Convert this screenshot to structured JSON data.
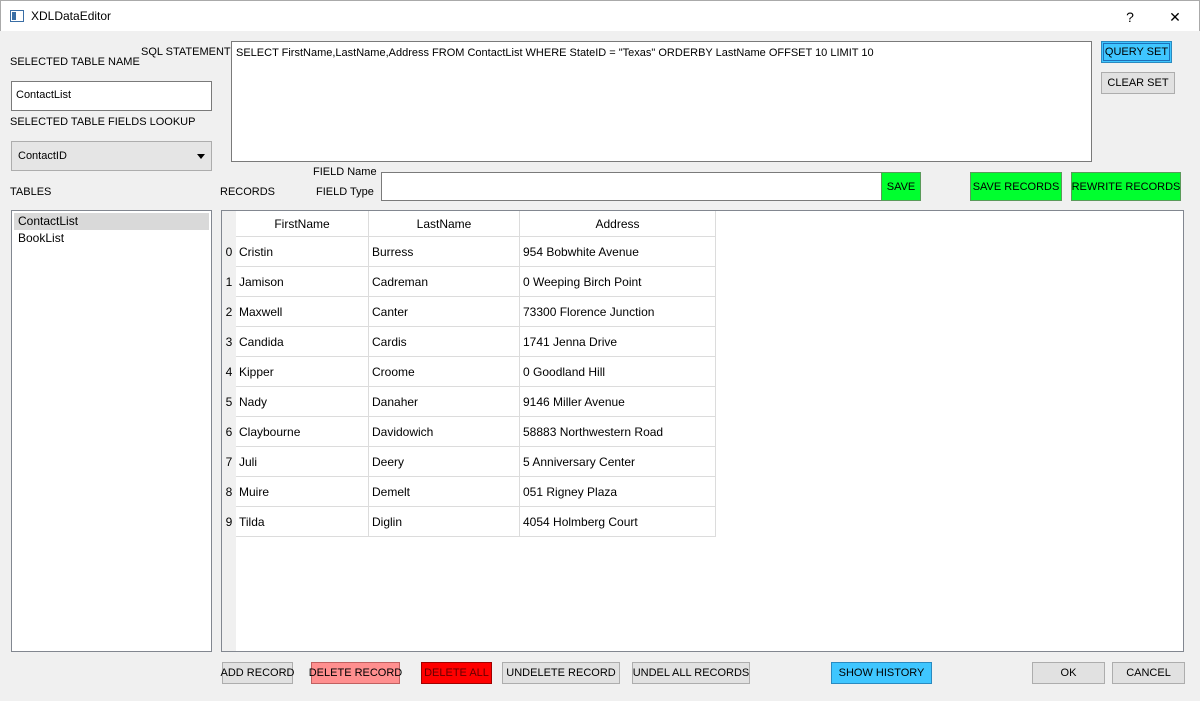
{
  "window": {
    "title": "XDLDataEditor",
    "help": "?",
    "close": "✕"
  },
  "labels": {
    "selected_table_name": "SELECTED TABLE NAME",
    "sql_statement": "SQL STATEMENT",
    "selected_table_fields_lookup": "SELECTED TABLE FIELDS LOOKUP",
    "tables": "TABLES",
    "records": "RECORDS",
    "field_name": "FIELD Name",
    "field_type": "FIELD Type"
  },
  "inputs": {
    "table_name": "ContactList",
    "sql": "SELECT FirstName,LastName,Address FROM ContactList WHERE StateID = \"Texas\"  ORDERBY LastName OFFSET 10 LIMIT 10",
    "field_value": ""
  },
  "fields_combo": {
    "selected": "ContactID"
  },
  "tables_list": [
    "ContactList",
    "BookList"
  ],
  "buttons": {
    "query_set": "QUERY SET",
    "clear_set": "CLEAR SET",
    "save": "SAVE",
    "save_records": "SAVE RECORDS",
    "rewrite_records": "REWRITE RECORDS",
    "add_record": "ADD RECORD",
    "delete_record": "DELETE RECORD",
    "delete_all": "DELETE ALL",
    "undelete_record": "UNDELETE RECORD",
    "undel_all_records": "UNDEL ALL RECORDS",
    "show_history": "SHOW HISTORY",
    "ok": "OK",
    "cancel": "CANCEL"
  },
  "grid": {
    "columns": [
      "FirstName",
      "LastName",
      "Address"
    ],
    "rows": [
      {
        "index": "0",
        "cells": [
          "Cristin",
          "Burress",
          "954 Bobwhite Avenue"
        ]
      },
      {
        "index": "1",
        "cells": [
          "Jamison",
          "Cadreman",
          "0 Weeping Birch Point"
        ]
      },
      {
        "index": "2",
        "cells": [
          "Maxwell",
          "Canter",
          "73300 Florence Junction"
        ]
      },
      {
        "index": "3",
        "cells": [
          "Candida",
          "Cardis",
          "1741 Jenna Drive"
        ]
      },
      {
        "index": "4",
        "cells": [
          "Kipper",
          "Croome",
          "0 Goodland Hill"
        ]
      },
      {
        "index": "5",
        "cells": [
          "Nady",
          "Danaher",
          "9146 Miller Avenue"
        ]
      },
      {
        "index": "6",
        "cells": [
          "Claybourne",
          "Davidowich",
          "58883 Northwestern Road"
        ]
      },
      {
        "index": "7",
        "cells": [
          "Juli",
          "Deery",
          "5 Anniversary Center"
        ]
      },
      {
        "index": "8",
        "cells": [
          "Muire",
          "Demelt",
          "051 Rigney Plaza"
        ]
      },
      {
        "index": "9",
        "cells": [
          "Tilda",
          "Diglin",
          "4054 Holmberg Court"
        ]
      }
    ]
  }
}
